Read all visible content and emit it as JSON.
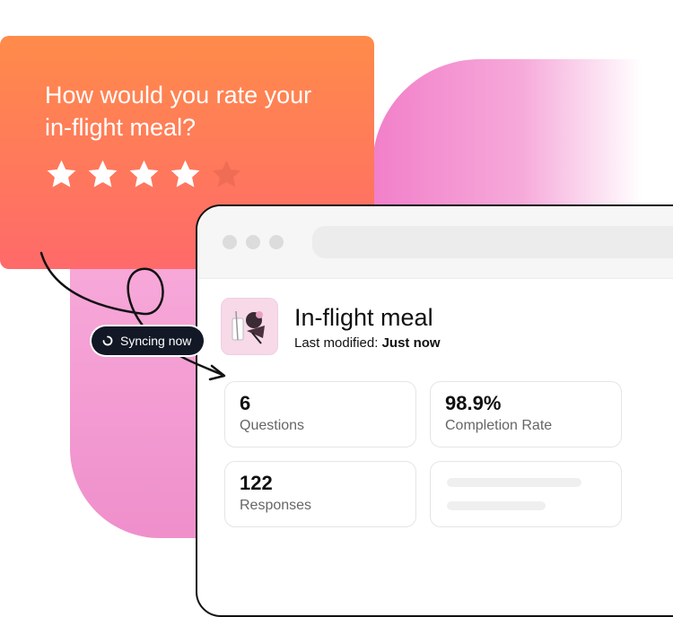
{
  "survey": {
    "question": "How would you rate your in-flight meal?",
    "rating": 4,
    "max_rating": 5,
    "star_color": "#ffffff",
    "empty_star_color": "#f06d55"
  },
  "sync": {
    "label": "Syncing now",
    "icon": "spinner-icon"
  },
  "dashboard": {
    "title": "In-flight meal",
    "modified_label": "Last modified:",
    "modified_value": "Just now",
    "stats": [
      {
        "value": "6",
        "label": "Questions"
      },
      {
        "value": "98.9%",
        "label": "Completion Rate"
      },
      {
        "value": "122",
        "label": "Responses"
      }
    ]
  },
  "colors": {
    "survey_gradient_top": "#ff8b4a",
    "survey_gradient_bottom": "#ff6a6a",
    "accent_pink": "#f27fc9",
    "badge_dark": "#121826"
  }
}
